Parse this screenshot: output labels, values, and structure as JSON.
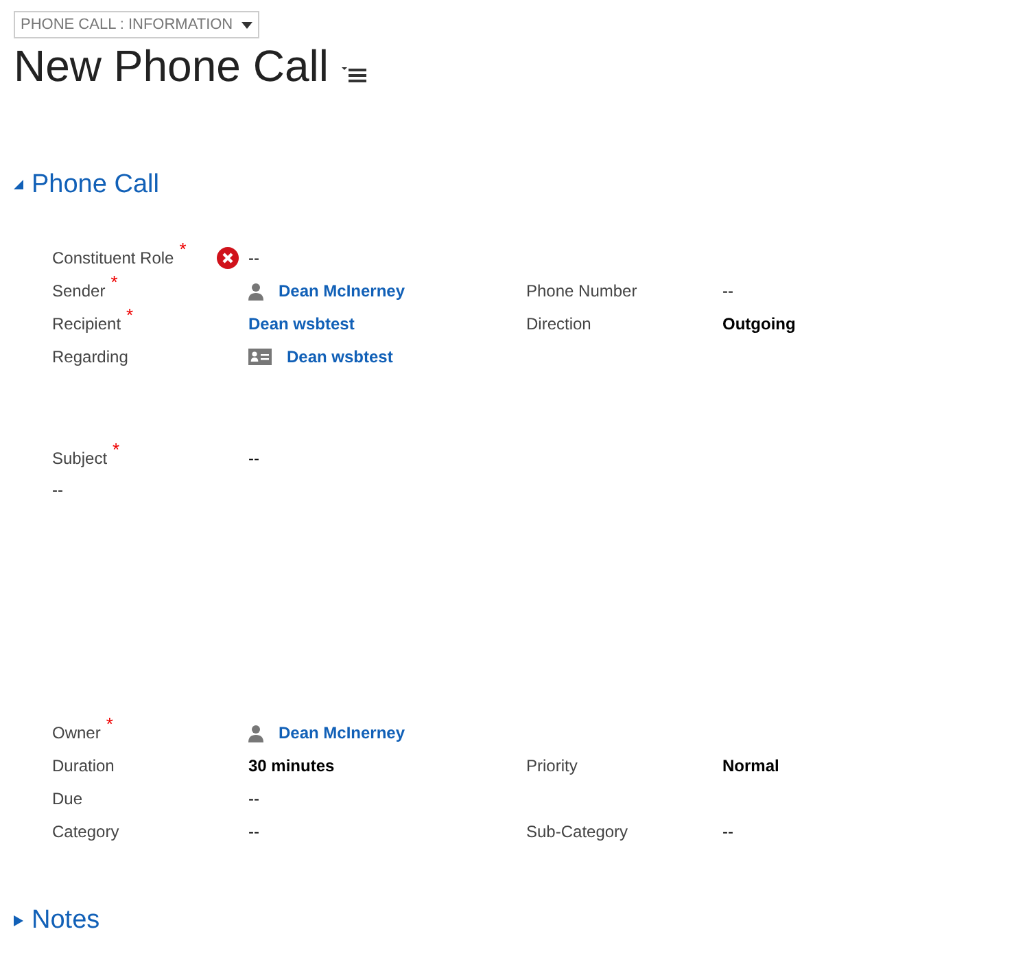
{
  "form_selector": {
    "label": "PHONE CALL : INFORMATION"
  },
  "title": "New Phone Call",
  "required_mark": "*",
  "sections": [
    {
      "title": "Phone Call",
      "expanded": true,
      "groups": [
        {
          "kind": "pairs",
          "rows": [
            {
              "left": {
                "label": "Constituent Role",
                "required": true,
                "kind": "invalid",
                "value": "--"
              }
            },
            {
              "left": {
                "label": "Sender",
                "required": true,
                "kind": "user",
                "value": "Dean McInerney"
              },
              "right": {
                "label": "Phone Number",
                "required": false,
                "kind": "text",
                "value": "--"
              }
            },
            {
              "left": {
                "label": "Recipient",
                "required": true,
                "kind": "lookup",
                "value": "Dean wsbtest"
              },
              "right": {
                "label": "Direction",
                "required": false,
                "kind": "emphasis",
                "value": "Outgoing"
              }
            },
            {
              "left": {
                "label": "Regarding",
                "required": false,
                "kind": "record",
                "value": "Dean wsbtest"
              }
            }
          ]
        },
        {
          "kind": "subject",
          "label": "Subject",
          "required": true,
          "value": "--",
          "description": "--"
        },
        {
          "kind": "pairs",
          "rows": [
            {
              "left": {
                "label": "Owner",
                "required": true,
                "kind": "user",
                "value": "Dean McInerney"
              }
            },
            {
              "left": {
                "label": "Duration",
                "required": false,
                "kind": "emphasis",
                "value": "30 minutes"
              },
              "right": {
                "label": "Priority",
                "required": false,
                "kind": "emphasis",
                "value": "Normal"
              }
            },
            {
              "left": {
                "label": "Due",
                "required": false,
                "kind": "text",
                "value": "--"
              }
            },
            {
              "left": {
                "label": "Category",
                "required": false,
                "kind": "text",
                "value": "--"
              },
              "right": {
                "label": "Sub-Category",
                "required": false,
                "kind": "text",
                "value": "--"
              }
            }
          ]
        }
      ]
    },
    {
      "title": "Notes",
      "expanded": false
    }
  ]
}
